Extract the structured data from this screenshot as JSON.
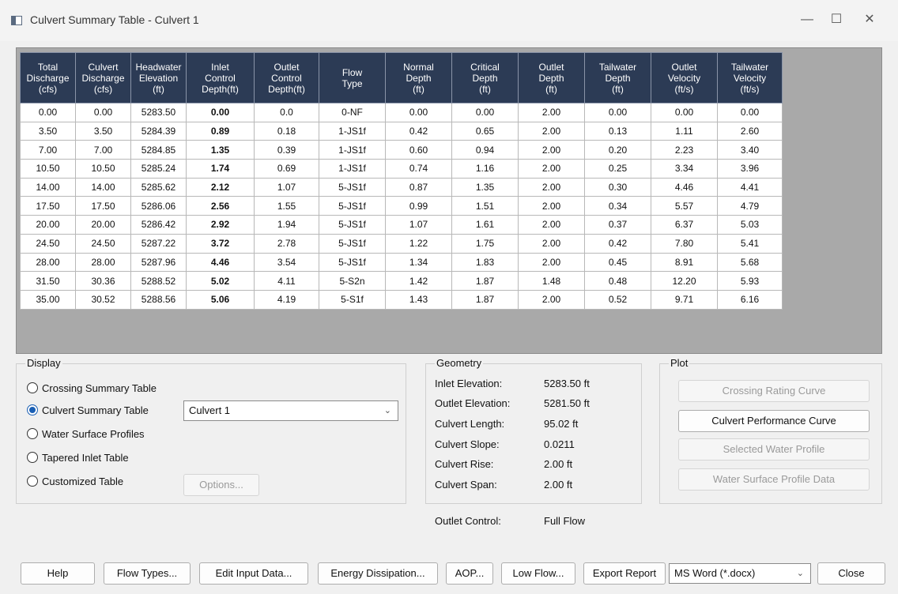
{
  "window": {
    "title": "Culvert Summary Table - Culvert 1"
  },
  "table": {
    "headers": [
      [
        "Total",
        "Discharge",
        "(cfs)"
      ],
      [
        "Culvert",
        "Discharge",
        "(cfs)"
      ],
      [
        "Headwater",
        "Elevation",
        "(ft)"
      ],
      [
        "Inlet",
        "Control",
        "Depth(ft)"
      ],
      [
        "Outlet",
        "Control",
        "Depth(ft)"
      ],
      [
        "Flow",
        "Type"
      ],
      [
        "Normal",
        "Depth",
        "(ft)"
      ],
      [
        "Critical",
        "Depth",
        "(ft)"
      ],
      [
        "Outlet",
        "Depth",
        "(ft)"
      ],
      [
        "Tailwater",
        "Depth",
        "(ft)"
      ],
      [
        "Outlet",
        "Velocity",
        "(ft/s)"
      ],
      [
        "Tailwater",
        "Velocity",
        "(ft/s)"
      ]
    ],
    "rows": [
      [
        "0.00",
        "0.00",
        "5283.50",
        "0.00",
        "0.0",
        "0-NF",
        "0.00",
        "0.00",
        "2.00",
        "0.00",
        "0.00",
        "0.00"
      ],
      [
        "3.50",
        "3.50",
        "5284.39",
        "0.89",
        "0.18",
        "1-JS1f",
        "0.42",
        "0.65",
        "2.00",
        "0.13",
        "1.11",
        "2.60"
      ],
      [
        "7.00",
        "7.00",
        "5284.85",
        "1.35",
        "0.39",
        "1-JS1f",
        "0.60",
        "0.94",
        "2.00",
        "0.20",
        "2.23",
        "3.40"
      ],
      [
        "10.50",
        "10.50",
        "5285.24",
        "1.74",
        "0.69",
        "1-JS1f",
        "0.74",
        "1.16",
        "2.00",
        "0.25",
        "3.34",
        "3.96"
      ],
      [
        "14.00",
        "14.00",
        "5285.62",
        "2.12",
        "1.07",
        "5-JS1f",
        "0.87",
        "1.35",
        "2.00",
        "0.30",
        "4.46",
        "4.41"
      ],
      [
        "17.50",
        "17.50",
        "5286.06",
        "2.56",
        "1.55",
        "5-JS1f",
        "0.99",
        "1.51",
        "2.00",
        "0.34",
        "5.57",
        "4.79"
      ],
      [
        "20.00",
        "20.00",
        "5286.42",
        "2.92",
        "1.94",
        "5-JS1f",
        "1.07",
        "1.61",
        "2.00",
        "0.37",
        "6.37",
        "5.03"
      ],
      [
        "24.50",
        "24.50",
        "5287.22",
        "3.72",
        "2.78",
        "5-JS1f",
        "1.22",
        "1.75",
        "2.00",
        "0.42",
        "7.80",
        "5.41"
      ],
      [
        "28.00",
        "28.00",
        "5287.96",
        "4.46",
        "3.54",
        "5-JS1f",
        "1.34",
        "1.83",
        "2.00",
        "0.45",
        "8.91",
        "5.68"
      ],
      [
        "31.50",
        "30.36",
        "5288.52",
        "5.02",
        "4.11",
        "5-S2n",
        "1.42",
        "1.87",
        "1.48",
        "0.48",
        "12.20",
        "5.93"
      ],
      [
        "35.00",
        "30.52",
        "5288.56",
        "5.06",
        "4.19",
        "5-S1f",
        "1.43",
        "1.87",
        "2.00",
        "0.52",
        "9.71",
        "6.16"
      ]
    ],
    "bold_column_index": 3
  },
  "display": {
    "title": "Display",
    "options": [
      {
        "label": "Crossing Summary Table",
        "checked": false
      },
      {
        "label": "Culvert Summary Table",
        "checked": true
      },
      {
        "label": "Water Surface Profiles",
        "checked": false
      },
      {
        "label": "Tapered Inlet Table",
        "checked": false
      },
      {
        "label": "Customized Table",
        "checked": false
      }
    ],
    "culvert_select": "Culvert 1",
    "options_button": "Options..."
  },
  "geometry": {
    "title": "Geometry",
    "items": [
      {
        "label": "Inlet Elevation:",
        "value": "5283.50 ft"
      },
      {
        "label": "Outlet Elevation:",
        "value": "5281.50 ft"
      },
      {
        "label": "Culvert Length:",
        "value": "95.02 ft"
      },
      {
        "label": "Culvert Slope:",
        "value": "0.0211"
      },
      {
        "label": "Culvert Rise:",
        "value": "2.00 ft"
      },
      {
        "label": "Culvert Span:",
        "value": "2.00 ft"
      }
    ],
    "outlet_control_label": "Outlet Control:",
    "outlet_control_value": "Full Flow"
  },
  "plot": {
    "title": "Plot",
    "buttons": [
      {
        "label": "Crossing Rating Curve",
        "enabled": false
      },
      {
        "label": "Culvert Performance Curve",
        "enabled": true
      },
      {
        "label": "Selected Water Profile",
        "enabled": false
      },
      {
        "label": "Water Surface Profile Data",
        "enabled": false
      }
    ]
  },
  "footer": {
    "help": "Help",
    "flow_types": "Flow Types...",
    "edit_input": "Edit Input Data...",
    "energy": "Energy Dissipation...",
    "aop": "AOP...",
    "low_flow": "Low Flow...",
    "export": "Export Report",
    "format": "MS Word (*.docx)",
    "close": "Close"
  }
}
